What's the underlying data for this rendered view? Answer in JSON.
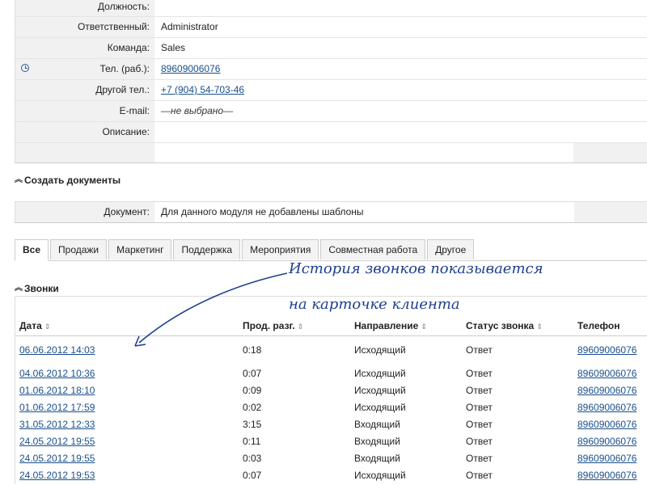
{
  "detail": {
    "rows": [
      {
        "label": "Должность",
        "value": ""
      },
      {
        "label": "Ответственный",
        "value": "Administrator"
      },
      {
        "label": "Команда",
        "value": "Sales"
      },
      {
        "label": "Тел. (раб.)",
        "value": "89609006076",
        "icon": "clock-icon"
      },
      {
        "label": "Другой тел.",
        "value": "+7 (904) 54-703-46"
      },
      {
        "label": "E-mail",
        "value": "—не выбрано—"
      },
      {
        "label": "Описание",
        "value": ""
      }
    ]
  },
  "documents": {
    "section_title": "Создать документы",
    "label": "Документ:",
    "value": "Для данного модуля не добавлены шаблоны"
  },
  "tabs": [
    "Все",
    "Продажи",
    "Маркетинг",
    "Поддержка",
    "Мероприятия",
    "Совместная работа",
    "Другое"
  ],
  "calls": {
    "section_title": "Звонки",
    "columns": [
      "Дата",
      "Прод. разг.",
      "Направление",
      "Статус звонка",
      "Телефон"
    ],
    "rows": [
      {
        "date": "06.06.2012 14:03",
        "duration": "0:18",
        "direction": "Исходящий",
        "status": "Ответ",
        "phone": "89609006076"
      },
      {
        "date": "04.06.2012 10:36",
        "duration": "0:07",
        "direction": "Исходящий",
        "status": "Ответ",
        "phone": "89609006076"
      },
      {
        "date": "01.06.2012 18:10",
        "duration": "0:09",
        "direction": "Исходящий",
        "status": "Ответ",
        "phone": "89609006076"
      },
      {
        "date": "01.06.2012 17:59",
        "duration": "0:02",
        "direction": "Исходящий",
        "status": "Ответ",
        "phone": "89609006076"
      },
      {
        "date": "31.05.2012 12:33",
        "duration": "3:15",
        "direction": "Входящий",
        "status": "Ответ",
        "phone": "89609006076"
      },
      {
        "date": "24.05.2012 19:55",
        "duration": "0:11",
        "direction": "Входящий",
        "status": "Ответ",
        "phone": "89609006076"
      },
      {
        "date": "24.05.2012 19:55",
        "duration": "0:03",
        "direction": "Входящий",
        "status": "Ответ",
        "phone": "89609006076"
      },
      {
        "date": "24.05.2012 19:53",
        "duration": "0:07",
        "direction": "Исходящий",
        "status": "Ответ",
        "phone": "89609006076"
      }
    ]
  },
  "annotation": {
    "line1": "История звонков показывается",
    "line2": "на карточке клиента",
    "color": "#1d3f8f"
  }
}
